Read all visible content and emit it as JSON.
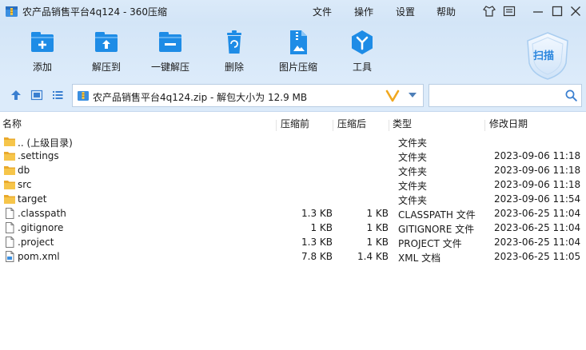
{
  "window": {
    "title": "农产品销售平台4q124 - 360压缩",
    "menu": [
      "文件",
      "操作",
      "设置",
      "帮助"
    ]
  },
  "toolbar": {
    "items": [
      {
        "label": "添加",
        "icon": "add-icon"
      },
      {
        "label": "解压到",
        "icon": "extract-to-icon"
      },
      {
        "label": "一键解压",
        "icon": "one-click-extract-icon"
      },
      {
        "label": "删除",
        "icon": "delete-icon"
      },
      {
        "label": "图片压缩",
        "icon": "image-compress-icon"
      },
      {
        "label": "工具",
        "icon": "tools-icon"
      }
    ],
    "scan_label": "扫描"
  },
  "address": {
    "path": "农产品销售平台4q124.zip - 解包大小为 12.9 MB",
    "search_value": ""
  },
  "columns": {
    "name": "名称",
    "packed": "压缩前",
    "size": "压缩后",
    "type": "类型",
    "modified": "修改日期"
  },
  "files": [
    {
      "name": ".. (上级目录)",
      "packed": "",
      "size": "",
      "type": "文件夹",
      "modified": "",
      "kind": "folder"
    },
    {
      "name": ".settings",
      "packed": "",
      "size": "",
      "type": "文件夹",
      "modified": "2023-09-06 11:18",
      "kind": "folder"
    },
    {
      "name": "db",
      "packed": "",
      "size": "",
      "type": "文件夹",
      "modified": "2023-09-06 11:18",
      "kind": "folder"
    },
    {
      "name": "src",
      "packed": "",
      "size": "",
      "type": "文件夹",
      "modified": "2023-09-06 11:18",
      "kind": "folder"
    },
    {
      "name": "target",
      "packed": "",
      "size": "",
      "type": "文件夹",
      "modified": "2023-09-06 11:54",
      "kind": "folder"
    },
    {
      "name": ".classpath",
      "packed": "1.3 KB",
      "size": "1 KB",
      "type": "CLASSPATH 文件",
      "modified": "2023-06-25 11:04",
      "kind": "file"
    },
    {
      "name": ".gitignore",
      "packed": "1 KB",
      "size": "1 KB",
      "type": "GITIGNORE 文件",
      "modified": "2023-06-25 11:04",
      "kind": "file"
    },
    {
      "name": ".project",
      "packed": "1.3 KB",
      "size": "1 KB",
      "type": "PROJECT 文件",
      "modified": "2023-06-25 11:04",
      "kind": "file"
    },
    {
      "name": "pom.xml",
      "packed": "7.8 KB",
      "size": "1.4 KB",
      "type": "XML 文档",
      "modified": "2023-06-25 11:05",
      "kind": "xml"
    }
  ],
  "colors": {
    "accent": "#1e8ce6",
    "titlebar": "#d3e5f7",
    "folder": "#f0b73c"
  }
}
